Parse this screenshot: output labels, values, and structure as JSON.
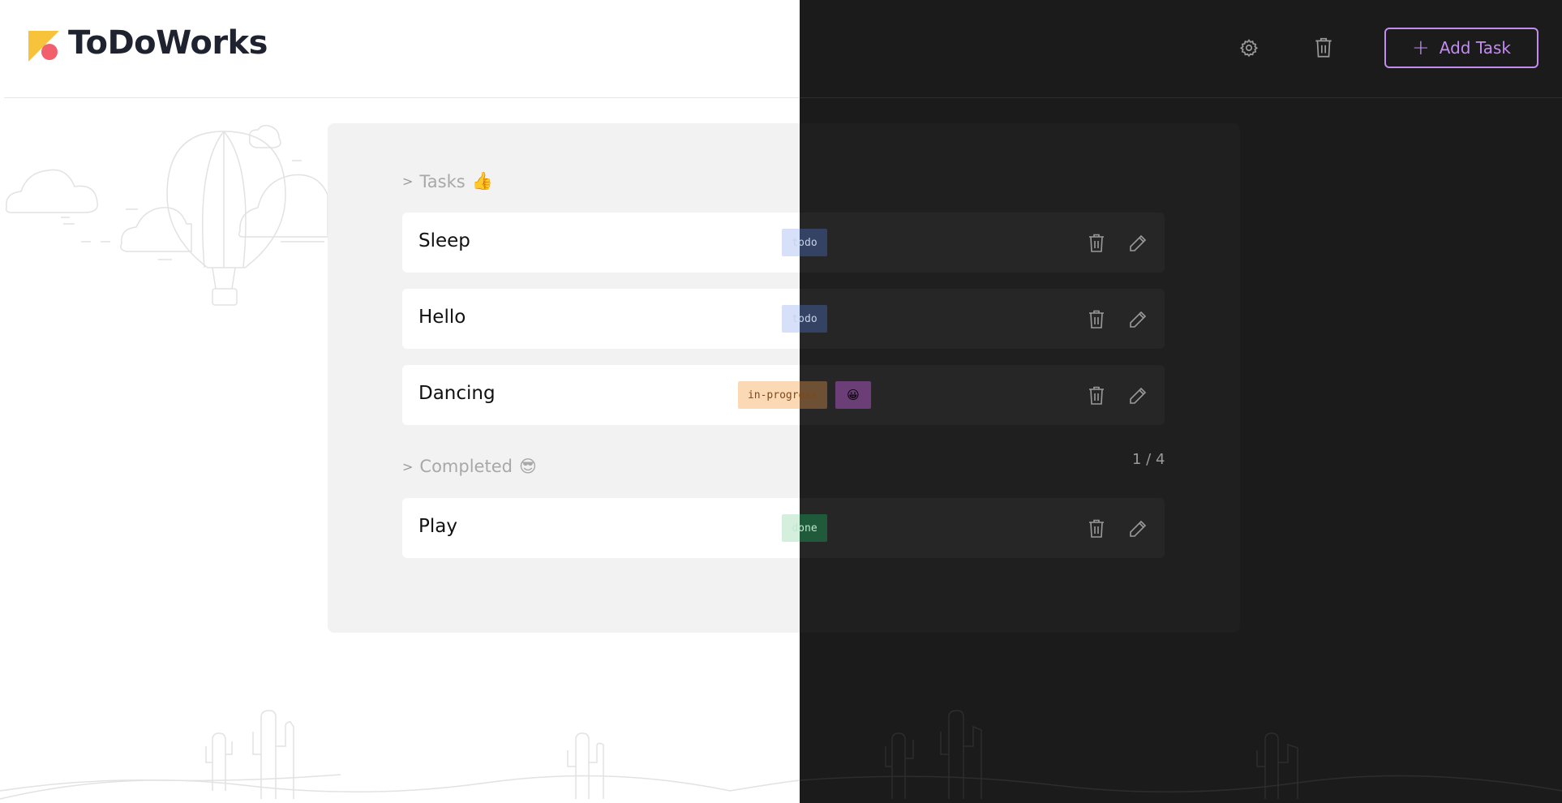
{
  "app": {
    "title": "ToDoWorks"
  },
  "header": {
    "settings_icon": "gear-icon",
    "trash_icon": "trash-icon",
    "add_button_label": "Add Task"
  },
  "sections": {
    "tasks_title": "Tasks",
    "tasks_emoji": "👍",
    "completed_title": "Completed",
    "completed_emoji": "😎",
    "chevron": ">"
  },
  "tasks": [
    {
      "name": "Sleep",
      "status": "todo"
    },
    {
      "name": "Hello",
      "status": "todo"
    },
    {
      "name": "Dancing",
      "status": "in-progress",
      "extra_badge": "😀"
    }
  ],
  "completed": [
    {
      "name": "Play",
      "status": "done"
    }
  ],
  "pagination": {
    "text": "1 / 4"
  },
  "colors": {
    "accent": "#c38cf0",
    "dark_bg": "#1b1b1b",
    "todo_light": "#d6e0f8",
    "todo_dark": "#344363",
    "progress_light": "#fcd9b5",
    "progress_dark": "#6e5034",
    "done_light": "#d4efdd",
    "done_dark": "#1f5b3a",
    "emoji_badge": "#6c3e78"
  }
}
